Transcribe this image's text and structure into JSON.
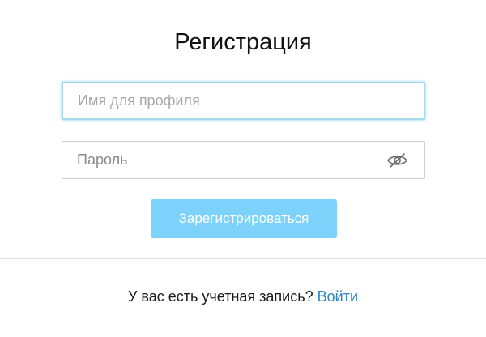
{
  "form": {
    "title": "Регистрация",
    "username": {
      "placeholder": "Имя для профиля",
      "value": ""
    },
    "password": {
      "placeholder": "Пароль",
      "value": "",
      "toggle_icon": "eye-slash-icon"
    },
    "submit_label": "Зарегистрироваться"
  },
  "footer": {
    "question": "У вас есть учетная запись?",
    "login_link": "Войти"
  },
  "colors": {
    "accent": "#7dd2fb",
    "link": "#2b86c4",
    "focus_border": "#a9d9ef",
    "input_border": "#cfcfcf",
    "divider": "#dedede"
  }
}
